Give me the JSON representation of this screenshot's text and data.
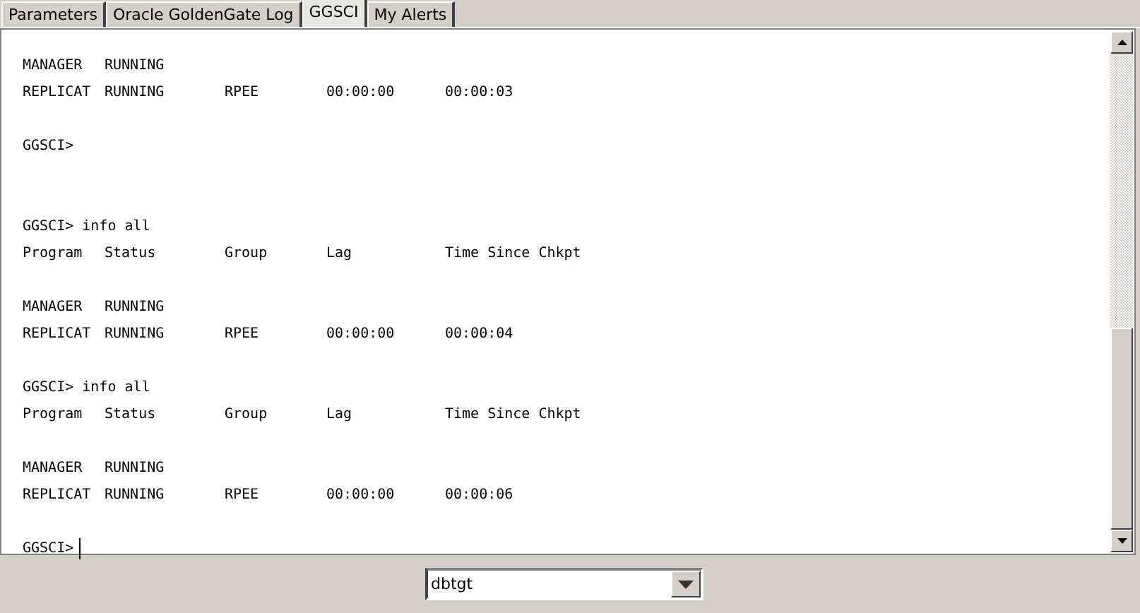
{
  "tabs": [
    {
      "label": "Parameters",
      "selected": false
    },
    {
      "label": "Oracle GoldenGate Log",
      "selected": false
    },
    {
      "label": "GGSCI",
      "selected": true
    },
    {
      "label": "My Alerts",
      "selected": false
    }
  ],
  "console": {
    "lines": [
      {
        "kind": "row",
        "cells": [
          "MANAGER",
          "RUNNING"
        ]
      },
      {
        "kind": "row",
        "cells": [
          "REPLICAT",
          "RUNNING",
          "RPEE",
          "00:00:00",
          "00:00:03"
        ]
      },
      {
        "kind": "blank"
      },
      {
        "kind": "text",
        "text": "GGSCI>"
      },
      {
        "kind": "blank"
      },
      {
        "kind": "blank"
      },
      {
        "kind": "text",
        "text": "GGSCI> info all"
      },
      {
        "kind": "row",
        "cells": [
          "Program",
          "Status",
          "Group",
          "Lag",
          "Time Since Chkpt"
        ]
      },
      {
        "kind": "blank"
      },
      {
        "kind": "row",
        "cells": [
          "MANAGER",
          "RUNNING"
        ]
      },
      {
        "kind": "row",
        "cells": [
          "REPLICAT",
          "RUNNING",
          "RPEE",
          "00:00:00",
          "00:00:04"
        ]
      },
      {
        "kind": "blank"
      },
      {
        "kind": "text",
        "text": "GGSCI> info all"
      },
      {
        "kind": "row",
        "cells": [
          "Program",
          "Status",
          "Group",
          "Lag",
          "Time Since Chkpt"
        ]
      },
      {
        "kind": "blank"
      },
      {
        "kind": "row",
        "cells": [
          "MANAGER",
          "RUNNING"
        ]
      },
      {
        "kind": "row",
        "cells": [
          "REPLICAT",
          "RUNNING",
          "RPEE",
          "00:00:00",
          "00:00:06"
        ]
      },
      {
        "kind": "blank"
      },
      {
        "kind": "prompt",
        "text": "GGSCI>"
      }
    ]
  },
  "instance_select": {
    "value": "dbtgt"
  }
}
